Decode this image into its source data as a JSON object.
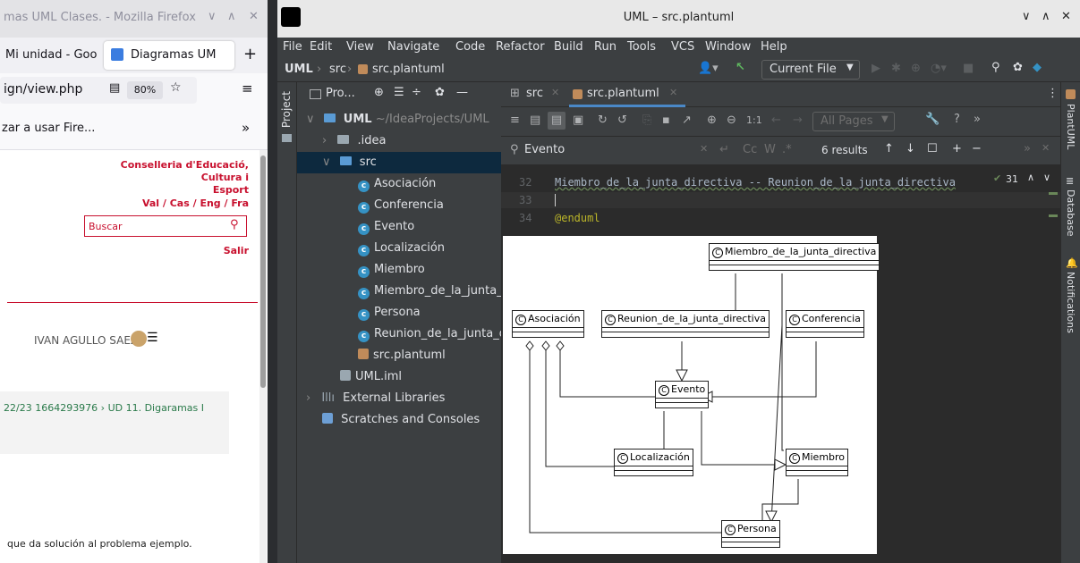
{
  "firefox": {
    "title": "mas UML Clases. - Mozilla Firefox",
    "tabs": [
      {
        "label": "Mi unidad - Goo"
      },
      {
        "label": "Diagramas UM"
      }
    ],
    "url": "ign/view.php",
    "zoom": "80%",
    "bookmark": "zar a usar Fire...",
    "page": {
      "org_line1": "Conselleria d'Educació, Cultura i",
      "org_line2": "Esport",
      "languages": "Val / Cas / Eng / Fra",
      "search_placeholder": "Buscar",
      "logout": "Salir",
      "user_name": "IVAN AGULLO SAEZ",
      "breadcrumb": "22/23 1664293976 › UD 11. Digaramas I",
      "footer_text": "que da solución al problema ejemplo."
    }
  },
  "ide": {
    "title": "UML – src.plantuml",
    "menu": [
      "File",
      "Edit",
      "View",
      "Navigate",
      "Code",
      "Refactor",
      "Build",
      "Run",
      "Tools",
      "VCS",
      "Window",
      "Help"
    ],
    "breadcrumb": [
      "UML",
      "src",
      "src.plantuml"
    ],
    "run_config": "Current File",
    "left_strip_label": "Project",
    "project_panel_title": "Pro...",
    "tree": {
      "root": "UML",
      "root_path": "~/IdeaProjects/UML",
      "idea": ".idea",
      "src": "src",
      "classes": [
        "Asociación",
        "Conferencia",
        "Evento",
        "Localización",
        "Miembro",
        "Miembro_de_la_junta_",
        "Persona",
        "Reunion_de_la_junta_d"
      ],
      "plantuml_file": "src.plantuml",
      "iml": "UML.iml",
      "external_libraries": "External Libraries",
      "scratches": "Scratches and Consoles"
    },
    "editor_tabs": [
      {
        "label": "src"
      },
      {
        "label": "src.plantuml"
      }
    ],
    "preview_toolbar": {
      "scale": "1:1",
      "pages": "All Pages"
    },
    "search": {
      "query": "Evento",
      "case": "Cc",
      "word": "W",
      "regex": ".*",
      "results": "6 results"
    },
    "code": [
      {
        "line": "32",
        "text": "Miembro_de_la_junta_directiva -- Reunion_de_la_junta_directiva"
      },
      {
        "line": "33",
        "text": ""
      },
      {
        "line": "34",
        "text": "@enduml"
      }
    ],
    "inspection_count": "31",
    "right_strip": [
      "PlantUML",
      "Database",
      "Notifications"
    ],
    "diagram": {
      "classes": {
        "miembro_junta": "Miembro_de_la_junta_directiva",
        "asociacion": "Asociación",
        "reunion": "Reunion_de_la_junta_directiva",
        "conferencia": "Conferencia",
        "evento": "Evento",
        "localizacion": "Localización",
        "miembro": "Miembro",
        "persona": "Persona"
      },
      "badge": "C"
    }
  },
  "colors": {
    "ide_bg": "#2b2b2b",
    "panel_bg": "#3c3f41",
    "selection": "#0d293e",
    "accent_blue": "#3592c4",
    "ff_link_red": "#c8102e",
    "ff_green": "#2a7a4a"
  }
}
